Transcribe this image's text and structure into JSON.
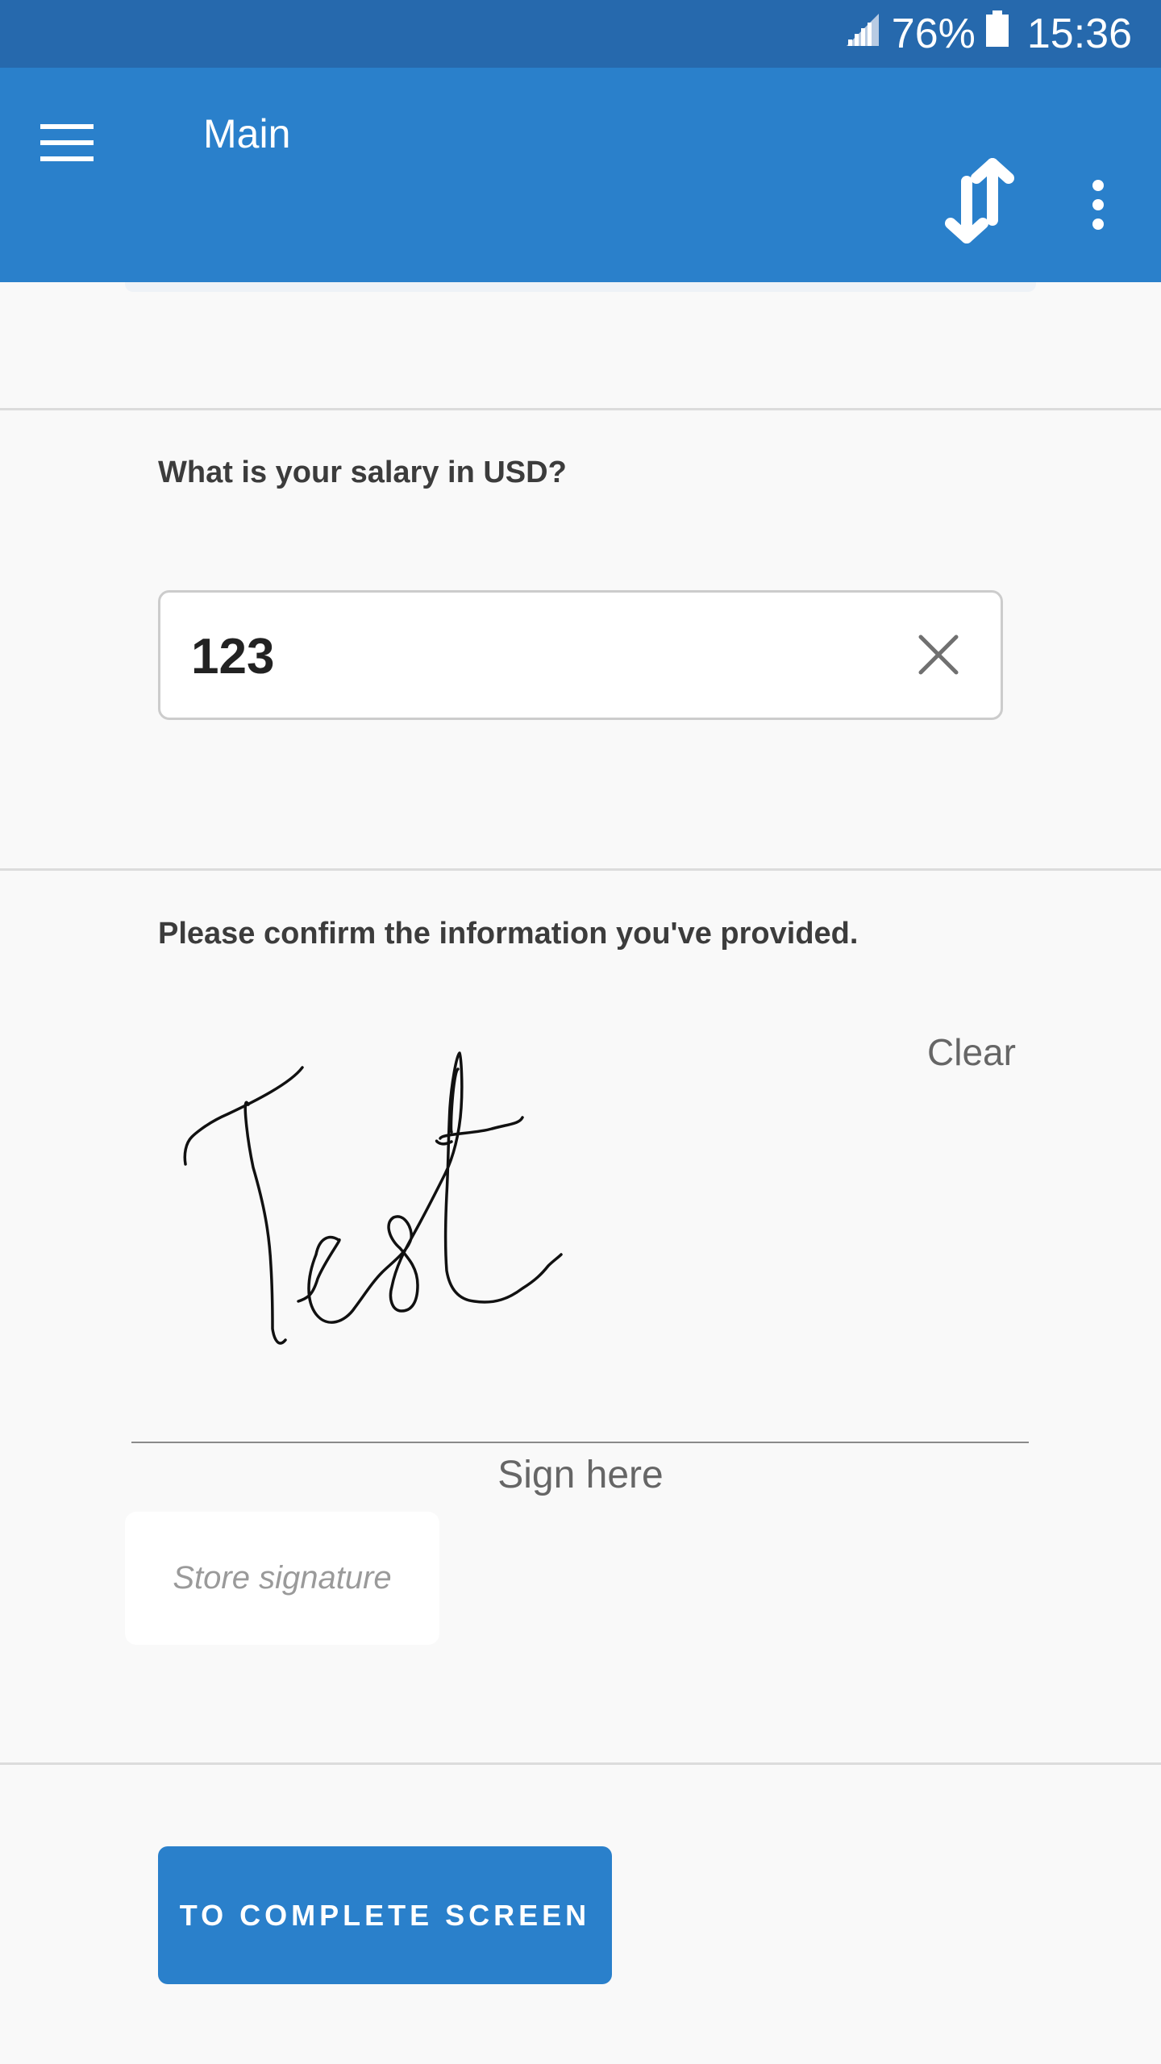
{
  "status_bar": {
    "battery_percent": "76%",
    "time": "15:36",
    "icons": [
      "signal-icon",
      "battery-icon"
    ]
  },
  "app_bar": {
    "title": "Main",
    "icons": [
      "menu-icon",
      "sync-icon",
      "more-vert-icon"
    ]
  },
  "colors": {
    "status_bar": "#2669ad",
    "app_bar": "#2a80cb",
    "primary_button": "#2a80cb",
    "background": "#f9f9f9"
  },
  "salary_question": {
    "label": "What is your salary in USD?",
    "value": "123",
    "clear_icon": "close-icon"
  },
  "confirmation": {
    "label": "Please confirm the information you've provided.",
    "clear_label": "Clear",
    "sign_here": "Sign here",
    "store_signature": "Store signature"
  },
  "footer": {
    "complete_button": "TO COMPLETE SCREEN"
  }
}
